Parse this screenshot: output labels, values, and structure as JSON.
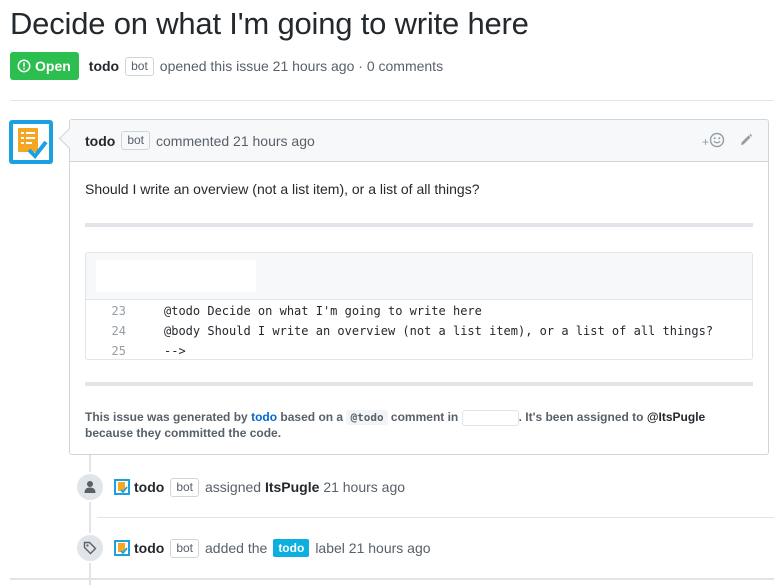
{
  "issue": {
    "title": "Decide on what I'm going to write here",
    "state_label": "Open",
    "author": "todo",
    "author_badge": "bot",
    "opened_text": "opened this issue 21 hours ago · 0 comments"
  },
  "comment": {
    "author": "todo",
    "author_badge": "bot",
    "action_text": "commented 21 hours ago",
    "reaction_label": "+",
    "body": "Should I write an overview (not a list item), or a list of all things?",
    "code_lines": [
      {
        "num": "23",
        "text": "@todo Decide on what I'm going to write here"
      },
      {
        "num": "24",
        "text": "@body Should I write an overview (not a list item), or a list of all things?"
      },
      {
        "num": "25",
        "text": "-->"
      }
    ],
    "footer": {
      "part1": "This issue was generated by",
      "link": "todo",
      "part2": "based on a",
      "code": "@todo",
      "part3": "comment in",
      "part4": ". It's been assigned to",
      "assignee": "@ItsPugle",
      "part5": "because they committed the code."
    }
  },
  "events": [
    {
      "author": "todo",
      "badge": "bot",
      "action": "assigned",
      "target": "ItsPugle",
      "time": "21 hours ago",
      "icon": "person-icon"
    },
    {
      "author": "todo",
      "badge": "bot",
      "action": "added the",
      "label": "todo",
      "suffix": "label",
      "time": "21 hours ago",
      "icon": "tag-icon"
    }
  ],
  "colors": {
    "open": "#2cbe4e",
    "label_todo": "#0bb0e0",
    "link": "#0366d6"
  }
}
